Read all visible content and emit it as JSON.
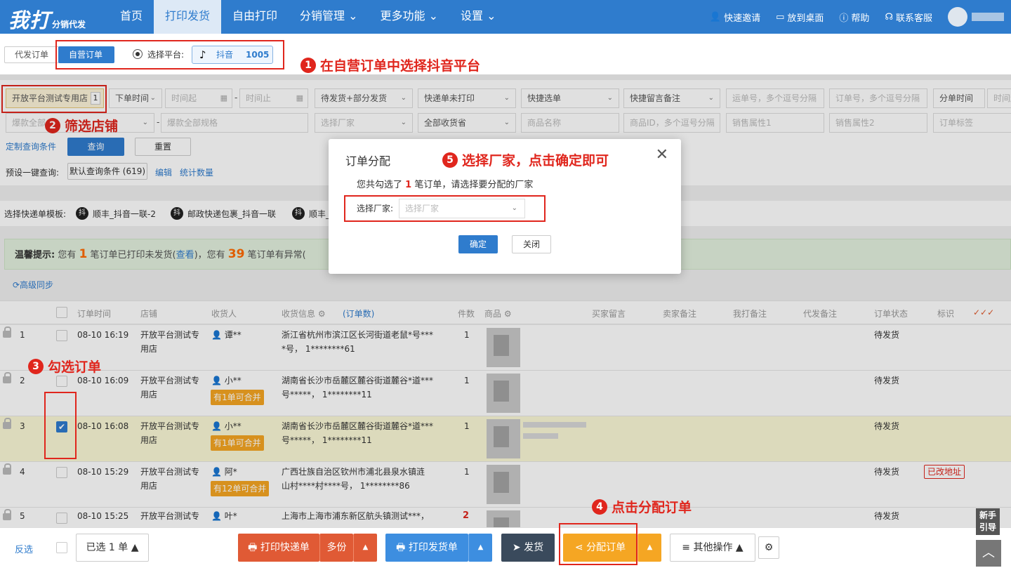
{
  "app": {
    "logo_main": "我打",
    "logo_sub": "分销代发"
  },
  "nav": [
    {
      "label": "首页"
    },
    {
      "label": "打印发货"
    },
    {
      "label": "自由打印"
    },
    {
      "label": "分销管理 ⌄"
    },
    {
      "label": "更多功能 ⌄"
    },
    {
      "label": "设置 ⌄"
    }
  ],
  "nav_right": {
    "invite": "快速邀请",
    "desktop": "放到桌面",
    "help": "帮助",
    "service": "联系客服"
  },
  "order_tabs": {
    "proxy": "代发订单",
    "own": "自营订单"
  },
  "platform": {
    "label": "选择平台:",
    "name": "抖音",
    "count": "1005"
  },
  "annotations": {
    "a1": {
      "num": "1",
      "text": "在自营订单中选择抖音平台"
    },
    "a2": {
      "num": "2",
      "text": "筛选店铺"
    },
    "a3": {
      "num": "3",
      "text": "勾选订单"
    },
    "a4": {
      "num": "4",
      "text": "点击分配订单"
    },
    "a5": {
      "num": "5",
      "text": "选择厂家，点击确定即可"
    }
  },
  "filters": {
    "shop": "开放平台测试专用店",
    "shop_count": "1",
    "order_time": "下单时间",
    "time_start": "时间起",
    "time_end": "时间止",
    "ship_status": "待发货+部分发货",
    "express_print": "快递单未打印",
    "quick_select": "快捷选单",
    "quick_remark": "快捷留言备注",
    "express_no": "运单号，多个逗号分隔",
    "order_no": "订单号，多个逗号分隔",
    "split_time": "分单时间",
    "time2": "时间起",
    "hot_all": "爆款全部",
    "hot_spec": "爆款全部规格",
    "vendor": "选择厂家",
    "province": "全部收货省",
    "goods_name": "商品名称",
    "goods_id": "商品ID，多个逗号分隔",
    "attr1": "销售属性1",
    "attr2": "销售属性2",
    "order_tag": "订单标签"
  },
  "query": {
    "custom": "定制查询条件",
    "search": "查询",
    "reset": "重置",
    "preset_label": "预设一键查询:",
    "preset_value": "默认查询条件 (619)",
    "edit": "编辑",
    "stats": "统计数量"
  },
  "templates": {
    "label": "选择快递单模板:",
    "t1": "顺丰_抖音一联-2",
    "t2": "邮政快递包裹_抖音一联",
    "t3": "顺丰_",
    "icon": "抖"
  },
  "tip": {
    "title": "温馨提示:",
    "p1": "您有",
    "n1": "1",
    "p2": "笔订单已打印未发货(",
    "view": "查看",
    "p3": ")，您有",
    "n2": "39",
    "p4": "笔订单有异常("
  },
  "sync": "⟳高级同步",
  "columns": {
    "time": "订单时间",
    "shop": "店铺",
    "receiver": "收货人",
    "address": "收货信息 ⚙",
    "order_no": "(订单数)",
    "qty": "件数",
    "goods": "商品 ⚙",
    "buyer_msg": "买家留言",
    "seller_note": "卖家备注",
    "my_note": "我打备注",
    "proxy_note": "代发备注",
    "status": "订单状态",
    "mark": "标识",
    "checks": "✓✓✓"
  },
  "rows": [
    {
      "idx": "1",
      "time": "08-10 16:19",
      "shop1": "开放平台测试专",
      "shop2": "用店",
      "recv": "谭**",
      "addr1": "浙江省杭州市滨江区长河街道老鼠*号***",
      "addr2": "*号， 1********61",
      "qty": "1",
      "status": "待发货",
      "merge": "",
      "tag": ""
    },
    {
      "idx": "2",
      "time": "08-10 16:09",
      "shop1": "开放平台测试专",
      "shop2": "用店",
      "recv": "小**",
      "addr1": "湖南省长沙市岳麓区麓谷街道麓谷*道***",
      "addr2": "号*****， 1********11",
      "qty": "1",
      "status": "待发货",
      "merge": "有1单可合并",
      "tag": ""
    },
    {
      "idx": "3",
      "time": "08-10 16:08",
      "shop1": "开放平台测试专",
      "shop2": "用店",
      "recv": "小**",
      "addr1": "湖南省长沙市岳麓区麓谷街道麓谷*道***",
      "addr2": "号*****， 1********11",
      "qty": "1",
      "status": "待发货",
      "merge": "有1单可合并",
      "tag": ""
    },
    {
      "idx": "4",
      "time": "08-10 15:29",
      "shop1": "开放平台测试专",
      "shop2": "用店",
      "recv": "阿*",
      "addr1": "广西壮族自治区钦州市浦北县泉水镇涟",
      "addr2": "山村****村****号， 1********86",
      "qty": "1",
      "status": "待发货",
      "merge": "有12单可合并",
      "tag": "已改地址"
    },
    {
      "idx": "5",
      "time": "08-10 15:25",
      "shop1": "开放平台测试专",
      "shop2": "",
      "recv": "叶*",
      "addr1": "上海市上海市浦东新区航头镇测试***，",
      "addr2": "",
      "qty": "2",
      "status": "待发货",
      "merge": "",
      "tag": ""
    }
  ],
  "footer": {
    "invert": "反选",
    "selected": "已选 1 单 ▲",
    "print_express": "打印快递单",
    "multi": "多份",
    "print_ship": "打印发货单",
    "ship": "发货",
    "assign": "分配订单",
    "other": "其他操作 ▲"
  },
  "side": {
    "newbie": "新手引导",
    "top": "︿"
  },
  "modal": {
    "title": "订单分配",
    "msg_pre": "您共勾选了",
    "msg_n": "1",
    "msg_post": "笔订单，请选择要分配的厂家",
    "select_label": "选择厂家:",
    "select_ph": "选择厂家",
    "ok": "确定",
    "close": "关闭"
  }
}
